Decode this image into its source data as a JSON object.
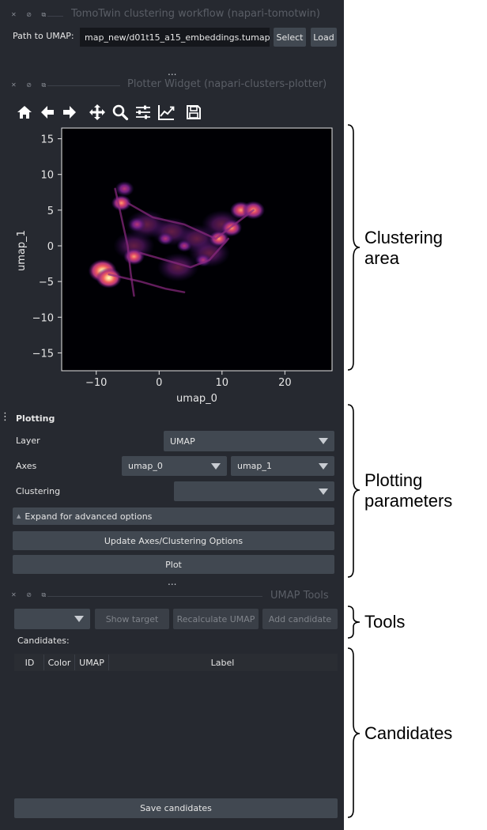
{
  "tomotwin": {
    "title": "TomoTwin clustering workflow (napari-tomotwin)",
    "path_label": "Path to UMAP:",
    "path_value": "map_new/d01t15_a15_embeddings.tumap",
    "select_label": "Select",
    "load_label": "Load"
  },
  "splitter_dots": "...",
  "plotter": {
    "title": "Plotter Widget (napari-clusters-plotter)",
    "toolbar": [
      "home-icon",
      "back-arrow-icon",
      "forward-arrow-icon",
      "pan-icon",
      "zoom-icon",
      "configure-subplots-icon",
      "edit-axis-icon",
      "save-icon"
    ]
  },
  "chart_data": {
    "type": "heatmap",
    "title": "",
    "xlabel": "umap_0",
    "ylabel": "umap_1",
    "xlim": [
      -15.5,
      27.5
    ],
    "ylim": [
      -17.5,
      16.5
    ],
    "xticks": [
      -10,
      0,
      10,
      20
    ],
    "xtick_labels": [
      "−10",
      "0",
      "10",
      "20"
    ],
    "yticks": [
      15,
      10,
      5,
      0,
      -5,
      -10,
      -15
    ],
    "ytick_labels": [
      "15",
      "10",
      "5",
      "0",
      "−5",
      "−10",
      "−15"
    ],
    "colormap": "magma",
    "background": "#000004",
    "grid": false,
    "clusters": [
      {
        "x": -9,
        "y": -3.5,
        "density": 1.0
      },
      {
        "x": -8,
        "y": -4.5,
        "density": 0.85
      },
      {
        "x": -6,
        "y": 6,
        "density": 0.55
      },
      {
        "x": -5.5,
        "y": 8,
        "density": 0.5
      },
      {
        "x": -3.5,
        "y": 3,
        "density": 0.45
      },
      {
        "x": -4,
        "y": -1.5,
        "density": 0.6
      },
      {
        "x": 1,
        "y": 1,
        "density": 0.35
      },
      {
        "x": 4,
        "y": 0,
        "density": 0.3
      },
      {
        "x": 7,
        "y": -2,
        "density": 0.35
      },
      {
        "x": 9.5,
        "y": 1,
        "density": 0.55
      },
      {
        "x": 11.5,
        "y": 2.5,
        "density": 0.6
      },
      {
        "x": 13,
        "y": 5,
        "density": 0.65
      },
      {
        "x": 15,
        "y": 5,
        "density": 0.7
      }
    ]
  },
  "plotting": {
    "header": "Plotting",
    "layer_label": "Layer",
    "layer_value": "UMAP",
    "axes_label": "Axes",
    "axis_x": "umap_0",
    "axis_y": "umap_1",
    "clustering_label": "Clustering",
    "clustering_value": "",
    "advanced_label": "Expand for advanced options",
    "update_label": "Update Axes/Clustering Options",
    "plot_label": "Plot"
  },
  "umap_tools": {
    "title": "UMAP Tools",
    "dropdown_value": "",
    "show_target_label": "Show target",
    "recalculate_label": "Recalculate UMAP",
    "add_candidate_label": "Add candidate",
    "candidates_label": "Candidates:",
    "columns": [
      "ID",
      "Color",
      "UMAP",
      "Label"
    ],
    "save_label": "Save candidates"
  },
  "annotations": {
    "clustering": [
      "Clustering",
      "area"
    ],
    "plotting": [
      "Plotting",
      "parameters"
    ],
    "tools": "Tools",
    "candidates": "Candidates"
  }
}
